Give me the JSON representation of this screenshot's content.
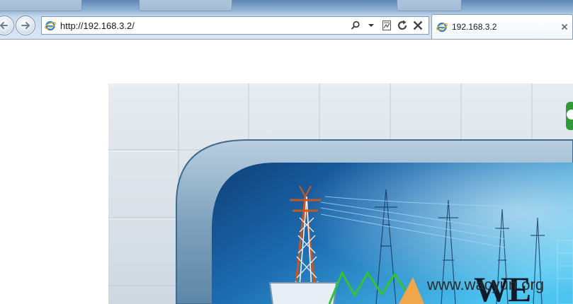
{
  "browser": {
    "address_bar": {
      "url": "http://192.168.3.2/"
    },
    "active_tab": {
      "title": "192.168.3.2"
    }
  },
  "page": {
    "watermark": "www.wacyun.org",
    "logo_text": "WE"
  },
  "colors": {
    "chrome_top": "#5f87b3",
    "chrome_bottom": "#d9e6f4",
    "tile_gray": "#dbe2ea",
    "panel_blue": "#1a5f9e",
    "panel_light": "#4fc3f0",
    "frame_steel": "#8fb0c8",
    "tower_orange": "#c9561e",
    "logo_green": "#2f9a3a"
  },
  "icons": {
    "back": "back-arrow-icon",
    "forward": "forward-arrow-icon",
    "page": "ie-page-icon",
    "search": "search-icon",
    "dropdown": "chevron-down-icon",
    "compat": "compatibility-view-icon",
    "refresh": "refresh-icon",
    "stop": "stop-icon",
    "close_tab": "close-icon"
  }
}
